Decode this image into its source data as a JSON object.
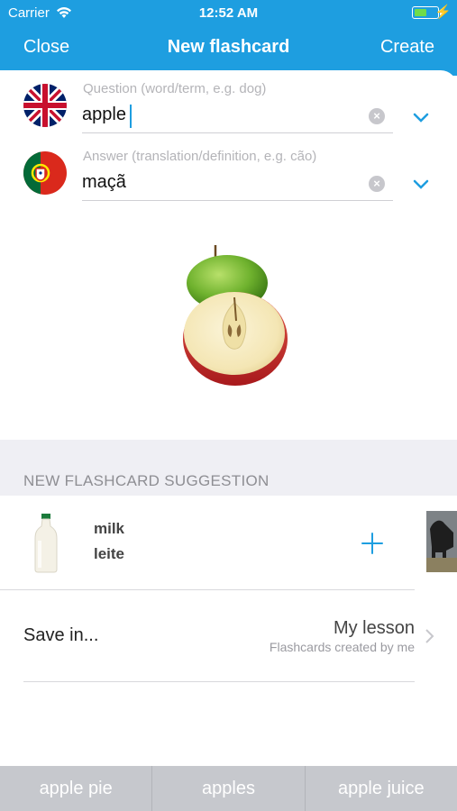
{
  "status": {
    "carrier": "Carrier",
    "time": "12:52 AM",
    "battery_level": 0.55,
    "battery_color": "#6fdc4a"
  },
  "navbar": {
    "close_label": "Close",
    "title": "New flashcard",
    "create_label": "Create",
    "color": "#1e9ee0"
  },
  "question": {
    "placeholder": "Question (word/term, e.g. dog)",
    "value": "apple",
    "flag": "uk-flag-icon"
  },
  "answer": {
    "placeholder": "Answer (translation/definition, e.g. cão)",
    "value": "maçã",
    "flag": "portugal-flag-icon"
  },
  "suggestion_section": {
    "title": "NEW FLASHCARD SUGGESTION",
    "term": "milk",
    "translation": "leite"
  },
  "save": {
    "label": "Save in...",
    "lesson": "My lesson",
    "lesson_subtitle": "Flashcards created by me"
  },
  "keyboard_suggestions": [
    "apple pie",
    "apples",
    "apple juice"
  ]
}
